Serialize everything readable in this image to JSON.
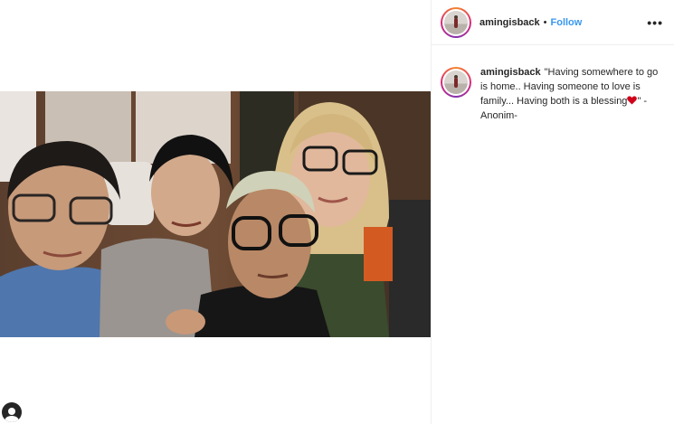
{
  "post": {
    "username": "amingisback",
    "separator": "•",
    "follow_label": "Follow",
    "more_icon": "more-options-icon",
    "caption": {
      "username": "amingisback",
      "text_before_emoji": "\"Having somewhere to go is home.. Having someone to love is family... Having both is a blessing",
      "emoji": "red-heart-icon",
      "text_after_emoji": "\" -Anonim-"
    },
    "photo_icon": "group-selfie-photo",
    "tag_icon": "user-tag-icon"
  },
  "colors": {
    "follow": "#3897f0",
    "text": "#262626",
    "border": "#efefef",
    "heart": "#d0021b"
  }
}
